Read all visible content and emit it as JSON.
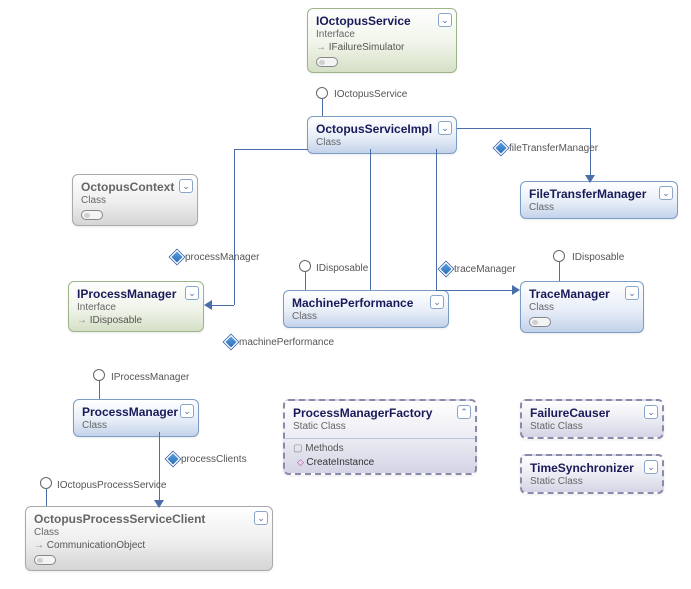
{
  "nodes": {
    "ioctopus": {
      "title": "IOctopusService",
      "sub": "Interface",
      "inh": "IFailureSimulator",
      "chev": "⌄"
    },
    "impl": {
      "title": "OctopusServiceImpl",
      "sub": "Class",
      "chev": "⌄"
    },
    "context": {
      "title": "OctopusContext",
      "sub": "Class",
      "chev": "⌄"
    },
    "iprocmgr": {
      "title": "IProcessManager",
      "sub": "Interface",
      "inh": "IDisposable",
      "chev": "⌄"
    },
    "machperf": {
      "title": "MachinePerformance",
      "sub": "Class",
      "chev": "⌄"
    },
    "ftm": {
      "title": "FileTransferManager",
      "sub": "Class",
      "chev": "⌄"
    },
    "trace": {
      "title": "TraceManager",
      "sub": "Class",
      "chev": "⌄"
    },
    "procmgr": {
      "title": "ProcessManager",
      "sub": "Class",
      "chev": "⌄"
    },
    "client": {
      "title": "OctopusProcessServiceClient",
      "sub": "Class",
      "inh": "CommunicationObject",
      "chev": "⌄"
    },
    "factory": {
      "title": "ProcessManagerFactory",
      "sub": "Static Class",
      "section": "Methods",
      "method": "CreateInstance",
      "chev": "⌃"
    },
    "causer": {
      "title": "FailureCauser",
      "sub": "Static Class",
      "chev": "⌄"
    },
    "sync": {
      "title": "TimeSynchronizer",
      "sub": "Static Class",
      "chev": "⌄"
    }
  },
  "labels": {
    "ioct_loll": "IOctopusService",
    "ftm_rel": "fileTransferManager",
    "pm_rel": "processManager",
    "idisp1": "IDisposable",
    "idisp2": "IDisposable",
    "tm_rel": "traceManager",
    "mp_rel": "machinePerformance",
    "ipm_loll": "IProcessManager",
    "pc_rel": "processClients",
    "iops_loll": "IOctopusProcessService"
  }
}
